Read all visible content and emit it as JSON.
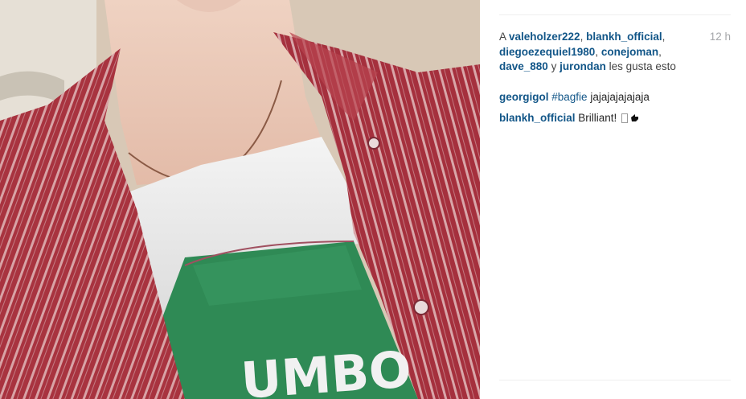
{
  "photo": {
    "description_icon": "selfie-photo",
    "shirt_print_text": "UMBO"
  },
  "likes": {
    "prefix": "A ",
    "users": [
      "valeholzer222",
      "blankh_official",
      "diegoezequiel1980",
      "conejoman",
      "dave_880"
    ],
    "last_user": "jurondan",
    "conjunction": " y ",
    "suffix": " les gusta esto"
  },
  "timestamp": "12 h",
  "comments": [
    {
      "user": "georgigol",
      "hashtag": "#bagfie",
      "text": " jajajajajajaja"
    },
    {
      "user": "blankh_official",
      "text": " Brilliant! "
    }
  ],
  "colors": {
    "link": "#125688",
    "muted": "#a5a7aa",
    "shirt_red": "#b33a48",
    "tee_green": "#2f8a55"
  }
}
